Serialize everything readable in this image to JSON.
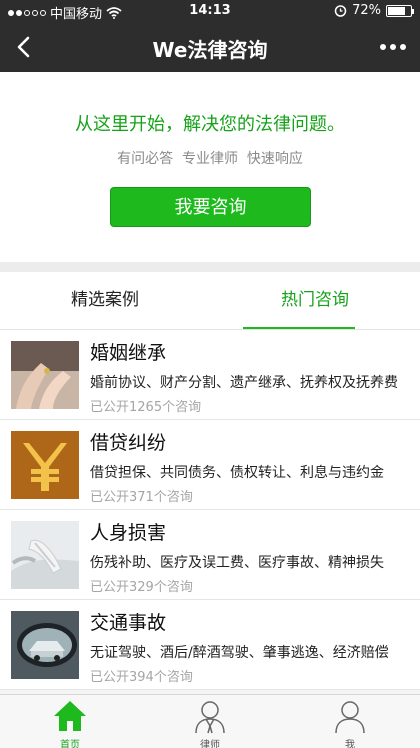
{
  "status_bar": {
    "carrier": "中国移动",
    "time": "14:13",
    "battery_text": "72%",
    "battery_level": 0.72
  },
  "nav": {
    "title": "We法律咨询"
  },
  "hero": {
    "headline": "从这里开始，解决您的法律问题。",
    "subline": "有问必答  专业律师  快速响应",
    "button_label": "我要咨询"
  },
  "tabs": [
    {
      "label": "精选案例"
    },
    {
      "label": "热门咨询",
      "active": true
    }
  ],
  "items": [
    {
      "title": "婚姻继承",
      "desc": "婚前协议、财产分割、遗产继承、抚养权及抚养费",
      "count": "已公开1265个咨询",
      "icon": "hands-photo"
    },
    {
      "title": "借贷纠纷",
      "desc": "借贷担保、共同债务、债权转让、利息与违约金",
      "count": "已公开371个咨询",
      "icon": "yuan-photo"
    },
    {
      "title": "人身损害",
      "desc": "伤残补助、医疗及误工费、医疗事故、精神损失",
      "count": "已公开329个咨询",
      "icon": "injury-photo"
    },
    {
      "title": "交通事故",
      "desc": "无证驾驶、酒后/醉酒驾驶、肇事逃逸、经济赔偿",
      "count": "已公开394个咨询",
      "icon": "car-mirror-photo"
    }
  ],
  "tab_bar": {
    "home": "首页",
    "lawyer": "律师",
    "me": "我"
  },
  "colors": {
    "accent": "#1db91d",
    "nav_bg": "#2d2d2d"
  }
}
